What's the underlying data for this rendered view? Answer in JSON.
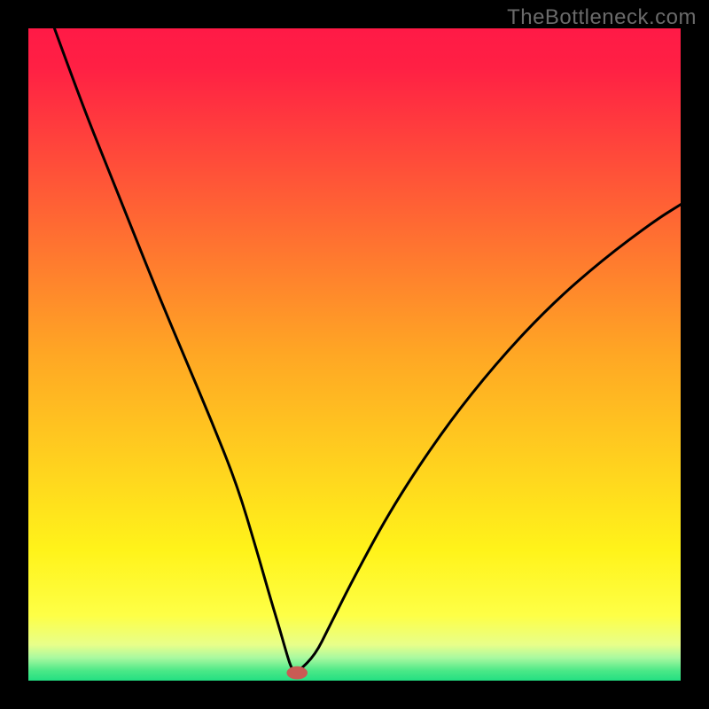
{
  "watermark": "TheBottleneck.com",
  "chart_data": {
    "type": "line",
    "title": "",
    "xlabel": "",
    "ylabel": "",
    "xlim": [
      0,
      100
    ],
    "ylim": [
      0,
      100
    ],
    "background": {
      "gradient_stops": [
        {
          "pos": 0.0,
          "color": "#ff1a46"
        },
        {
          "pos": 0.06,
          "color": "#ff2044"
        },
        {
          "pos": 0.5,
          "color": "#ffa724"
        },
        {
          "pos": 0.8,
          "color": "#fff31a"
        },
        {
          "pos": 0.9,
          "color": "#feff46"
        },
        {
          "pos": 0.945,
          "color": "#e8ff8a"
        },
        {
          "pos": 0.965,
          "color": "#a9f9a0"
        },
        {
          "pos": 0.985,
          "color": "#4ae887"
        },
        {
          "pos": 1.0,
          "color": "#23df82"
        }
      ]
    },
    "series": [
      {
        "name": "bottleneck-curve",
        "color": "#000000",
        "x": [
          4,
          8,
          12,
          16,
          20,
          24,
          28,
          32,
          35,
          37,
          38.5,
          39.5,
          40.2,
          40.8,
          41.5,
          44,
          46,
          50,
          56,
          64,
          72,
          80,
          88,
          96,
          100
        ],
        "y": [
          100,
          89,
          79,
          69,
          59,
          49.5,
          40,
          30,
          20,
          13,
          8,
          4.5,
          2.2,
          1.3,
          1.5,
          4,
          8,
          16,
          27,
          39,
          49,
          57.5,
          64.5,
          70.5,
          73
        ]
      }
    ],
    "marker": {
      "name": "optimal-point",
      "x": 41.2,
      "y": 1.2,
      "color": "#c95b54",
      "rx": 1.6,
      "ry": 1.0
    }
  }
}
